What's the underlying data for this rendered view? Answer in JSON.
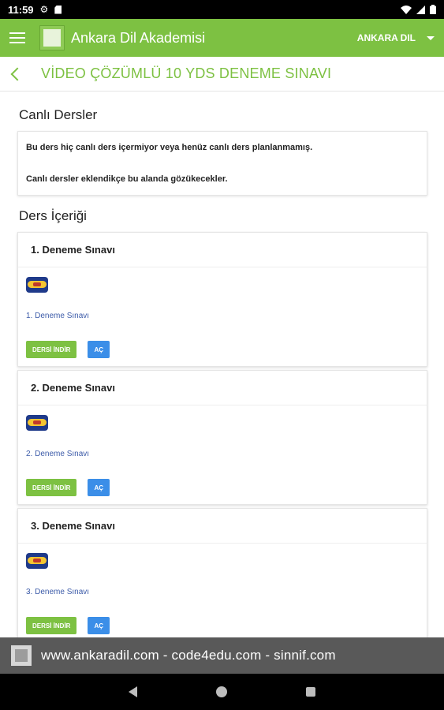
{
  "status_bar": {
    "time": "11:59",
    "icons": [
      "gear-icon",
      "sd-card-icon",
      "wifi-icon",
      "signal-icon",
      "battery-icon"
    ]
  },
  "app_bar": {
    "title": "Ankara Dil Akademisi",
    "account": "ANKARA DIL",
    "color": "#7dc142"
  },
  "course": {
    "title": "VİDEO ÇÖZÜMLÜ 10 YDS DENEME SINAVI"
  },
  "live_section": {
    "title": "Canlı Dersler",
    "messages": [
      "Bu ders hiç canlı ders içermiyor veya henüz canlı ders planlanmamış.",
      "Canlı dersler eklendikçe bu alanda gözükecekler."
    ]
  },
  "content_section": {
    "title": "Ders İçeriği",
    "lessons": [
      {
        "title": "1. Deneme Sınavı",
        "link": "1. Deneme Sınavı",
        "download_label": "DERSİ İNDİR",
        "open_label": "AÇ"
      },
      {
        "title": "2. Deneme Sınavı",
        "link": "2. Deneme Sınavı",
        "download_label": "DERSİ İNDİR",
        "open_label": "AÇ"
      },
      {
        "title": "3. Deneme Sınavı",
        "link": "3. Deneme Sınavı",
        "download_label": "DERSİ İNDİR",
        "open_label": "AÇ"
      }
    ]
  },
  "footer": {
    "text": "www.ankaradil.com - code4edu.com - sinnif.com"
  },
  "colors": {
    "accent_green": "#7dc142",
    "button_blue": "#3b8ee8",
    "footer_bg": "#595959"
  }
}
